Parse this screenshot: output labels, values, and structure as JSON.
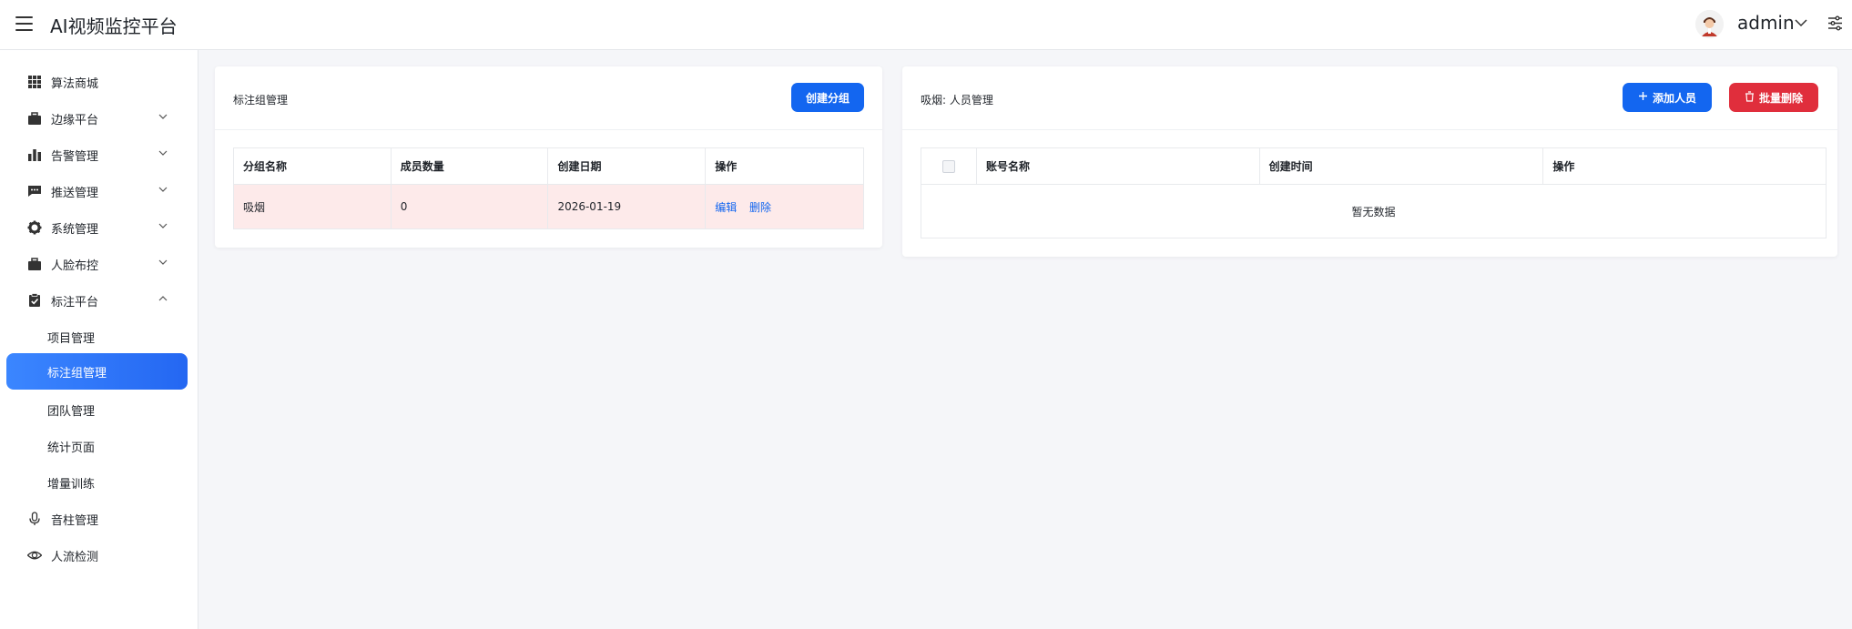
{
  "header": {
    "title": "AI视频监控平台",
    "user_name": "admin"
  },
  "sidebar": {
    "items": [
      {
        "label": "算法商城",
        "icon": "grid-icon"
      },
      {
        "label": "边缘平台",
        "icon": "briefcase-icon"
      },
      {
        "label": "告警管理",
        "icon": "bar-chart-icon"
      },
      {
        "label": "推送管理",
        "icon": "message-icon"
      },
      {
        "label": "系统管理",
        "icon": "gear-icon"
      },
      {
        "label": "人脸布控",
        "icon": "briefcase-icon"
      },
      {
        "label": "标注平台",
        "icon": "clipboard-check-icon"
      }
    ],
    "sub_items": [
      {
        "label": "项目管理"
      },
      {
        "label": "标注组管理",
        "active": true
      },
      {
        "label": "团队管理"
      },
      {
        "label": "统计页面"
      },
      {
        "label": "增量训练"
      }
    ],
    "bottom_items": [
      {
        "label": "音柱管理",
        "icon": "microphone-icon"
      },
      {
        "label": "人流检测",
        "icon": "eye-icon"
      }
    ]
  },
  "left_panel": {
    "title": "标注组管理",
    "create_button": "创建分组",
    "columns": [
      "分组名称",
      "成员数量",
      "创建日期",
      "操作"
    ],
    "rows": [
      {
        "name": "吸烟",
        "count": "0",
        "date": "2026-01-19",
        "actions": [
          "编辑",
          "删除"
        ]
      }
    ]
  },
  "right_panel": {
    "title": "吸烟: 人员管理",
    "add_button": "添加人员",
    "batch_delete_button": "批量删除",
    "columns": [
      "账号名称",
      "创建时间",
      "操作"
    ],
    "empty_text": "暂无数据"
  },
  "colors": {
    "primary": "#1366f0",
    "danger": "#e02e3c",
    "active_nav": "#2467f2",
    "highlight_row": "#fdeaea"
  }
}
